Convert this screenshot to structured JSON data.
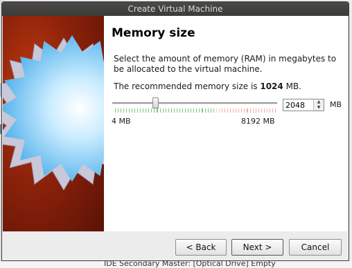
{
  "window": {
    "title": "Create Virtual Machine"
  },
  "page": {
    "heading": "Memory size",
    "description": "Select the amount of memory (RAM) in megabytes to be allocated to the virtual machine.",
    "recommended_prefix": "The recommended memory size is ",
    "recommended_value": "1024",
    "recommended_suffix": " MB."
  },
  "memory": {
    "value": "2048",
    "unit": "MB",
    "slider_min_label": "4 MB",
    "slider_max_label": "8192 MB",
    "slider_fraction": 0.25
  },
  "buttons": {
    "back": "< Back",
    "next": "Next >",
    "cancel": "Cancel"
  },
  "background_text": "IDE Secondary Master:   [Optical Drive] Empty",
  "colors": {
    "tick_green": "#7dc47d",
    "tick_light": "#d7d7d7",
    "tick_red": "#f0a8a8"
  }
}
